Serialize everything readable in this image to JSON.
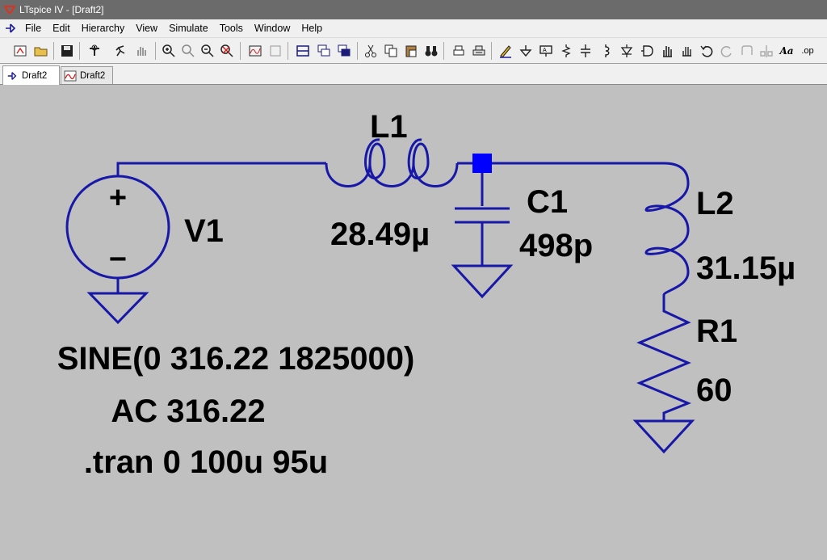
{
  "window": {
    "title": "LTspice IV - [Draft2]"
  },
  "menu": {
    "items": [
      {
        "label": "File"
      },
      {
        "label": "Edit"
      },
      {
        "label": "Hierarchy"
      },
      {
        "label": "View"
      },
      {
        "label": "Simulate"
      },
      {
        "label": "Tools"
      },
      {
        "label": "Window"
      },
      {
        "label": "Help"
      }
    ]
  },
  "toolbar": {
    "buttons": [
      "new-schematic",
      "open",
      "save",
      "control-panel",
      "run",
      "halt",
      "zoom-in",
      "pan",
      "zoom-out",
      "zoom-cancel",
      "autorange",
      "zoom-fit",
      "tile",
      "cascade",
      "close-all",
      "cut",
      "copy",
      "paste",
      "find",
      "print-setup",
      "print",
      "draw-wire",
      "ground",
      "label-net",
      "resistor",
      "capacitor",
      "inductor",
      "diode",
      "component",
      "move",
      "drag",
      "undo",
      "redo",
      "rotate",
      "mirror",
      "text",
      "spice-directive"
    ],
    "text_label": "Aa",
    "op_label": ".op"
  },
  "tabs": [
    {
      "label": "Draft2",
      "kind": "schematic",
      "active": true
    },
    {
      "label": "Draft2",
      "kind": "waveform",
      "active": false
    }
  ],
  "schematic": {
    "wire_color": "#1818a8",
    "labels": {
      "l1_name": "L1",
      "l1_value": "28.49µ",
      "c1_name": "C1",
      "c1_value": "498p",
      "l2_name": "L2",
      "l2_value": "31.15µ",
      "r1_name": "R1",
      "r1_value": "60",
      "v1_name": "V1",
      "v1_plus": "+",
      "v1_minus": "−"
    },
    "directives": {
      "sine": "SINE(0 316.22 1825000)",
      "ac": "AC 316.22",
      "tran": ".tran 0 100u 95u"
    }
  }
}
